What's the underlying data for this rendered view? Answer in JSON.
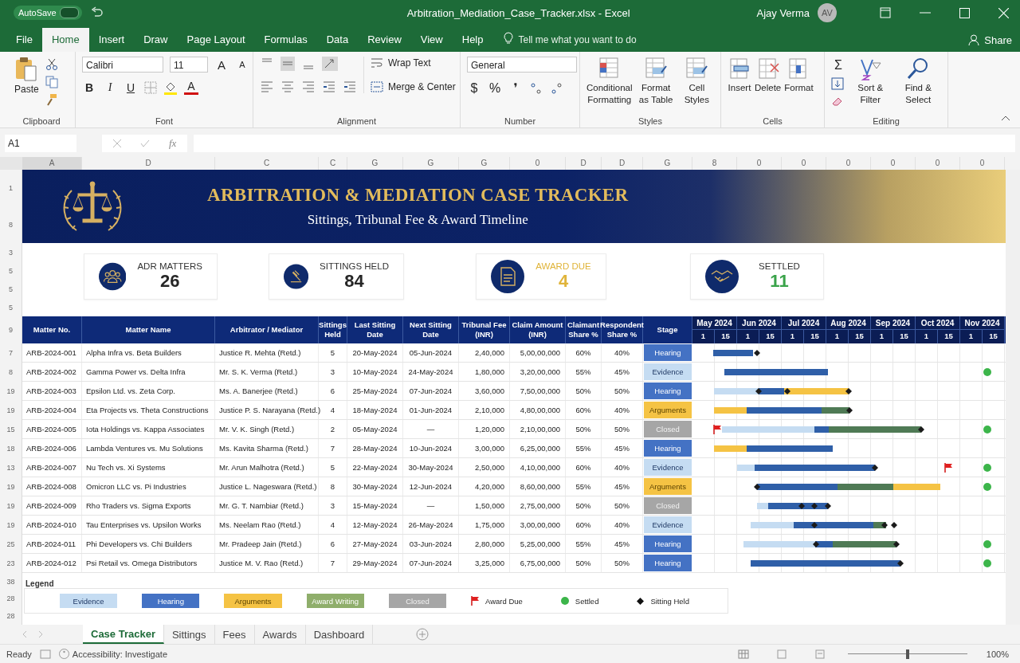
{
  "titlebar": {
    "autosave": "AutoSave",
    "autosave_on": false,
    "title": "Arbitration_Mediation_Case_Tracker.xlsx  -  Excel",
    "user": "Ajay Verma",
    "avatar": "AV"
  },
  "menu": {
    "tabs": [
      {
        "label": "File",
        "selected": false
      },
      {
        "label": "Home",
        "selected": true
      },
      {
        "label": "Insert",
        "selected": false
      },
      {
        "label": "Draw",
        "selected": false
      },
      {
        "label": "Page Layout",
        "selected": false
      },
      {
        "label": "Formulas",
        "selected": false
      },
      {
        "label": "Data",
        "selected": false
      },
      {
        "label": "Review",
        "selected": false
      },
      {
        "label": "View",
        "selected": false
      },
      {
        "label": "Help",
        "selected": false
      }
    ],
    "tell_me": "Tell me what you want to do",
    "share": "Share"
  },
  "ribbon": {
    "clipboard": {
      "paste": "Paste",
      "label": "Clipboard"
    },
    "font": {
      "name": "Calibri",
      "size": "11",
      "grow": "A",
      "shrink": "A",
      "bold": "B",
      "italic": "I",
      "underline": "U",
      "font_color_button": "A",
      "label": "Font"
    },
    "alignment": {
      "wrap": "Wrap Text",
      "merge": "Merge & Center",
      "label": "Alignment"
    },
    "number": {
      "format": "General",
      "currency": "$",
      "percent": "%",
      "comma": "❜",
      "label": "Number"
    },
    "styles": {
      "buttons": [
        "Conditional Formatting",
        "Format as Table",
        "Cell Styles"
      ],
      "label": "Styles"
    },
    "cells": {
      "buttons": [
        "Insert",
        "Delete",
        "Format"
      ],
      "label": "Cells"
    },
    "editing": {
      "sum": "Σ",
      "buttons": [
        "Sort & Filter",
        "Find & Select"
      ],
      "label": "Editing"
    }
  },
  "formula_bar": {
    "name_box": "A1",
    "fx": "fx"
  },
  "column_headers": [
    "A",
    "D",
    "C",
    "C",
    "G",
    "G",
    "G",
    "0",
    "D",
    "D",
    "G",
    "8",
    "0",
    "0",
    "0",
    "0",
    "0",
    "0"
  ],
  "row_numbers": {
    "banner": [
      "1",
      "8"
    ],
    "kpis": [
      "3",
      "5",
      "5",
      "5"
    ],
    "header": [
      "9"
    ],
    "rows": [
      "7",
      "8",
      "19",
      "19",
      "15",
      "18",
      "13",
      "19",
      "19",
      "19",
      "25",
      "23"
    ],
    "legend": [
      "38",
      "28",
      "28"
    ]
  },
  "banner": {
    "title": "ARBITRATION & MEDIATION CASE TRACKER",
    "subtitle": "Sittings, Tribunal Fee & Award Timeline"
  },
  "kpis": [
    {
      "label": "ADR MATTERS",
      "value": "26",
      "highlight": false,
      "color": "#262626"
    },
    {
      "label": "SITTINGS HELD",
      "value": "84",
      "highlight": false,
      "color": "#262626"
    },
    {
      "label": "AWARD DUE",
      "value": "4",
      "highlight": true,
      "color": "#e0b43a"
    },
    {
      "label": "SETTLED",
      "value": "11",
      "highlight": false,
      "color": "#3aa34a"
    }
  ],
  "table": {
    "columns": [
      "Matter No.",
      "Matter Name",
      "Arbitrator / Mediator",
      "Sittings Held",
      "Last Sitting Date",
      "Next Sitting Date",
      "Tribunal Fee (INR)",
      "Claim Amount (INR)",
      "Claimant Share %",
      "Respondent Share %",
      "Stage"
    ],
    "months": [
      {
        "label": "May 2024",
        "days": [
          "1",
          "15"
        ]
      },
      {
        "label": "Jun 2024",
        "days": [
          "1",
          "15"
        ]
      },
      {
        "label": "Jul 2024",
        "days": [
          "1",
          "15"
        ]
      },
      {
        "label": "Aug 2024",
        "days": [
          "1",
          "15"
        ]
      },
      {
        "label": "Sep 2024",
        "days": [
          "1",
          "15"
        ]
      },
      {
        "label": "Oct 2024",
        "days": [
          "1",
          "15"
        ]
      },
      {
        "label": "Nov 2024",
        "days": [
          "1",
          "15"
        ]
      }
    ],
    "rows": [
      {
        "cells": [
          "ARB-2024-001",
          "Alpha Infra vs. Beta Builders",
          "Justice R. Mehta (Retd.)",
          "5",
          "20-May-2024",
          "05-Jun-2024",
          "2,40,000",
          "5,00,00,000",
          "60%",
          "40%"
        ],
        "stage": {
          "label": "Hearing",
          "kind": "hearing"
        },
        "segments": [
          {
            "kind": "hearing"
          }
        ],
        "markers": [
          {
            "kind": "sitting"
          }
        ]
      },
      {
        "cells": [
          "ARB-2024-002",
          "Gamma Power vs. Delta Infra",
          "Mr. S. K. Verma (Retd.)",
          "3",
          "10-May-2024",
          "24-May-2024",
          "1,80,000",
          "3,20,00,000",
          "55%",
          "45%"
        ],
        "stage": {
          "label": "Evidence",
          "kind": "evidence"
        },
        "segments": [
          {
            "kind": "hearing"
          }
        ],
        "markers": [
          {
            "kind": "settled"
          }
        ]
      },
      {
        "cells": [
          "ARB-2024-003",
          "Epsilon Ltd. vs. Zeta Corp.",
          "Ms. A. Banerjee (Retd.)",
          "6",
          "25-May-2024",
          "07-Jun-2024",
          "3,60,000",
          "7,50,00,000",
          "50%",
          "50%"
        ],
        "stage": {
          "label": "Hearing",
          "kind": "hearing"
        },
        "segments": [
          {
            "kind": "evidence"
          },
          {
            "kind": "hearing"
          },
          {
            "kind": "arguments"
          }
        ],
        "markers": [
          {
            "kind": "sitting"
          },
          {
            "kind": "sitting"
          },
          {
            "kind": "sitting"
          }
        ]
      },
      {
        "cells": [
          "ARB-2024-004",
          "Eta Projects vs. Theta Constructions",
          "Justice P. S. Narayana (Retd.)",
          "4",
          "18-May-2024",
          "01-Jun-2024",
          "2,10,000",
          "4,80,00,000",
          "60%",
          "40%"
        ],
        "stage": {
          "label": "Arguments",
          "kind": "arguments"
        },
        "segments": [
          {
            "kind": "arguments"
          },
          {
            "kind": "hearing"
          },
          {
            "kind": "award"
          }
        ],
        "markers": [
          {
            "kind": "sitting"
          }
        ]
      },
      {
        "cells": [
          "ARB-2024-005",
          "Iota Holdings vs. Kappa Associates",
          "Mr. V. K. Singh (Retd.)",
          "2",
          "05-May-2024",
          "—",
          "1,20,000",
          "2,10,00,000",
          "50%",
          "50%"
        ],
        "stage": {
          "label": "Closed",
          "kind": "closed"
        },
        "segments": [
          {
            "kind": "evidence"
          },
          {
            "kind": "hearing"
          },
          {
            "kind": "award"
          }
        ],
        "markers": [
          {
            "kind": "award_due"
          },
          {
            "kind": "sitting"
          },
          {
            "kind": "settled"
          }
        ]
      },
      {
        "cells": [
          "ARB-2024-006",
          "Lambda Ventures vs. Mu Solutions",
          "Ms. Kavita Sharma (Retd.)",
          "7",
          "28-May-2024",
          "10-Jun-2024",
          "3,00,000",
          "6,25,00,000",
          "55%",
          "45%"
        ],
        "stage": {
          "label": "Hearing",
          "kind": "hearing"
        },
        "segments": [
          {
            "kind": "arguments"
          },
          {
            "kind": "hearing"
          }
        ]
      },
      {
        "cells": [
          "ARB-2024-007",
          "Nu Tech vs. Xi Systems",
          "Mr. Arun Malhotra (Retd.)",
          "5",
          "22-May-2024",
          "30-May-2024",
          "2,50,000",
          "4,10,00,000",
          "60%",
          "40%"
        ],
        "stage": {
          "label": "Evidence",
          "kind": "evidence"
        },
        "segments": [
          {
            "kind": "evidence"
          },
          {
            "kind": "hearing"
          }
        ],
        "markers": [
          {
            "kind": "sitting"
          },
          {
            "kind": "award_due"
          },
          {
            "kind": "settled"
          }
        ]
      },
      {
        "cells": [
          "ARB-2024-008",
          "Omicron LLC vs. Pi Industries",
          "Justice L. Nageswara (Retd.)",
          "8",
          "30-May-2024",
          "12-Jun-2024",
          "4,20,000",
          "8,60,00,000",
          "55%",
          "45%"
        ],
        "stage": {
          "label": "Arguments",
          "kind": "arguments"
        },
        "segments": [
          {
            "kind": "hearing"
          },
          {
            "kind": "award"
          },
          {
            "kind": "arguments"
          }
        ],
        "markers": [
          {
            "kind": "sitting"
          },
          {
            "kind": "settled"
          }
        ]
      },
      {
        "cells": [
          "ARB-2024-009",
          "Rho Traders vs. Sigma Exports",
          "Mr. G. T. Nambiar (Retd.)",
          "3",
          "15-May-2024",
          "—",
          "1,50,000",
          "2,75,00,000",
          "50%",
          "50%"
        ],
        "stage": {
          "label": "Closed",
          "kind": "closed"
        },
        "segments": [
          {
            "kind": "evidence"
          },
          {
            "kind": "hearing"
          }
        ],
        "markers": [
          {
            "kind": "sitting"
          },
          {
            "kind": "sitting"
          },
          {
            "kind": "sitting"
          }
        ]
      },
      {
        "cells": [
          "ARB-2024-010",
          "Tau Enterprises vs. Upsilon Works",
          "Ms. Neelam Rao (Retd.)",
          "4",
          "12-May-2024",
          "26-May-2024",
          "1,75,000",
          "3,00,00,000",
          "60%",
          "40%"
        ],
        "stage": {
          "label": "Evidence",
          "kind": "evidence"
        },
        "segments": [
          {
            "kind": "evidence"
          },
          {
            "kind": "hearing"
          },
          {
            "kind": "award"
          }
        ],
        "markers": [
          {
            "kind": "sitting"
          },
          {
            "kind": "sitting"
          },
          {
            "kind": "sitting"
          }
        ]
      },
      {
        "cells": [
          "ARB-2024-011",
          "Phi Developers vs. Chi Builders",
          "Mr. Pradeep Jain (Retd.)",
          "6",
          "27-May-2024",
          "03-Jun-2024",
          "2,80,000",
          "5,25,00,000",
          "55%",
          "45%"
        ],
        "stage": {
          "label": "Hearing",
          "kind": "hearing"
        },
        "segments": [
          {
            "kind": "evidence"
          },
          {
            "kind": "hearing"
          },
          {
            "kind": "award"
          }
        ],
        "markers": [
          {
            "kind": "sitting"
          },
          {
            "kind": "sitting"
          },
          {
            "kind": "settled"
          }
        ]
      },
      {
        "cells": [
          "ARB-2024-012",
          "Psi Retail vs. Omega Distributors",
          "Justice M. V. Rao (Retd.)",
          "7",
          "29-May-2024",
          "07-Jun-2024",
          "3,25,000",
          "6,75,00,000",
          "50%",
          "50%"
        ],
        "stage": {
          "label": "Hearing",
          "kind": "hearing"
        },
        "segments": [
          {
            "kind": "hearing"
          }
        ],
        "markers": [
          {
            "kind": "sitting"
          },
          {
            "kind": "settled"
          }
        ]
      }
    ]
  },
  "legend": {
    "title": "Legend",
    "items": [
      {
        "label": "Evidence",
        "kind": "evidence"
      },
      {
        "label": "Hearing",
        "kind": "hearing"
      },
      {
        "label": "Arguments",
        "kind": "arguments"
      },
      {
        "label": "Award Writing",
        "kind": "award"
      },
      {
        "label": "Closed",
        "kind": "closed"
      },
      {
        "label": "Award Due",
        "kind": "award_due"
      },
      {
        "label": "Settled",
        "kind": "settled"
      },
      {
        "label": "Sitting Held",
        "kind": "sitting"
      }
    ]
  },
  "sheet_tabs": [
    {
      "label": "Case Tracker",
      "selected": true
    },
    {
      "label": "Sittings",
      "selected": false
    },
    {
      "label": "Fees",
      "selected": false
    },
    {
      "label": "Awards",
      "selected": false
    },
    {
      "label": "Dashboard",
      "selected": false
    }
  ],
  "status": {
    "ready": "Ready",
    "accessibility": "Accessibility: Investigate",
    "zoom_slider": {
      "level": 0.5
    },
    "zoom": "100%"
  }
}
